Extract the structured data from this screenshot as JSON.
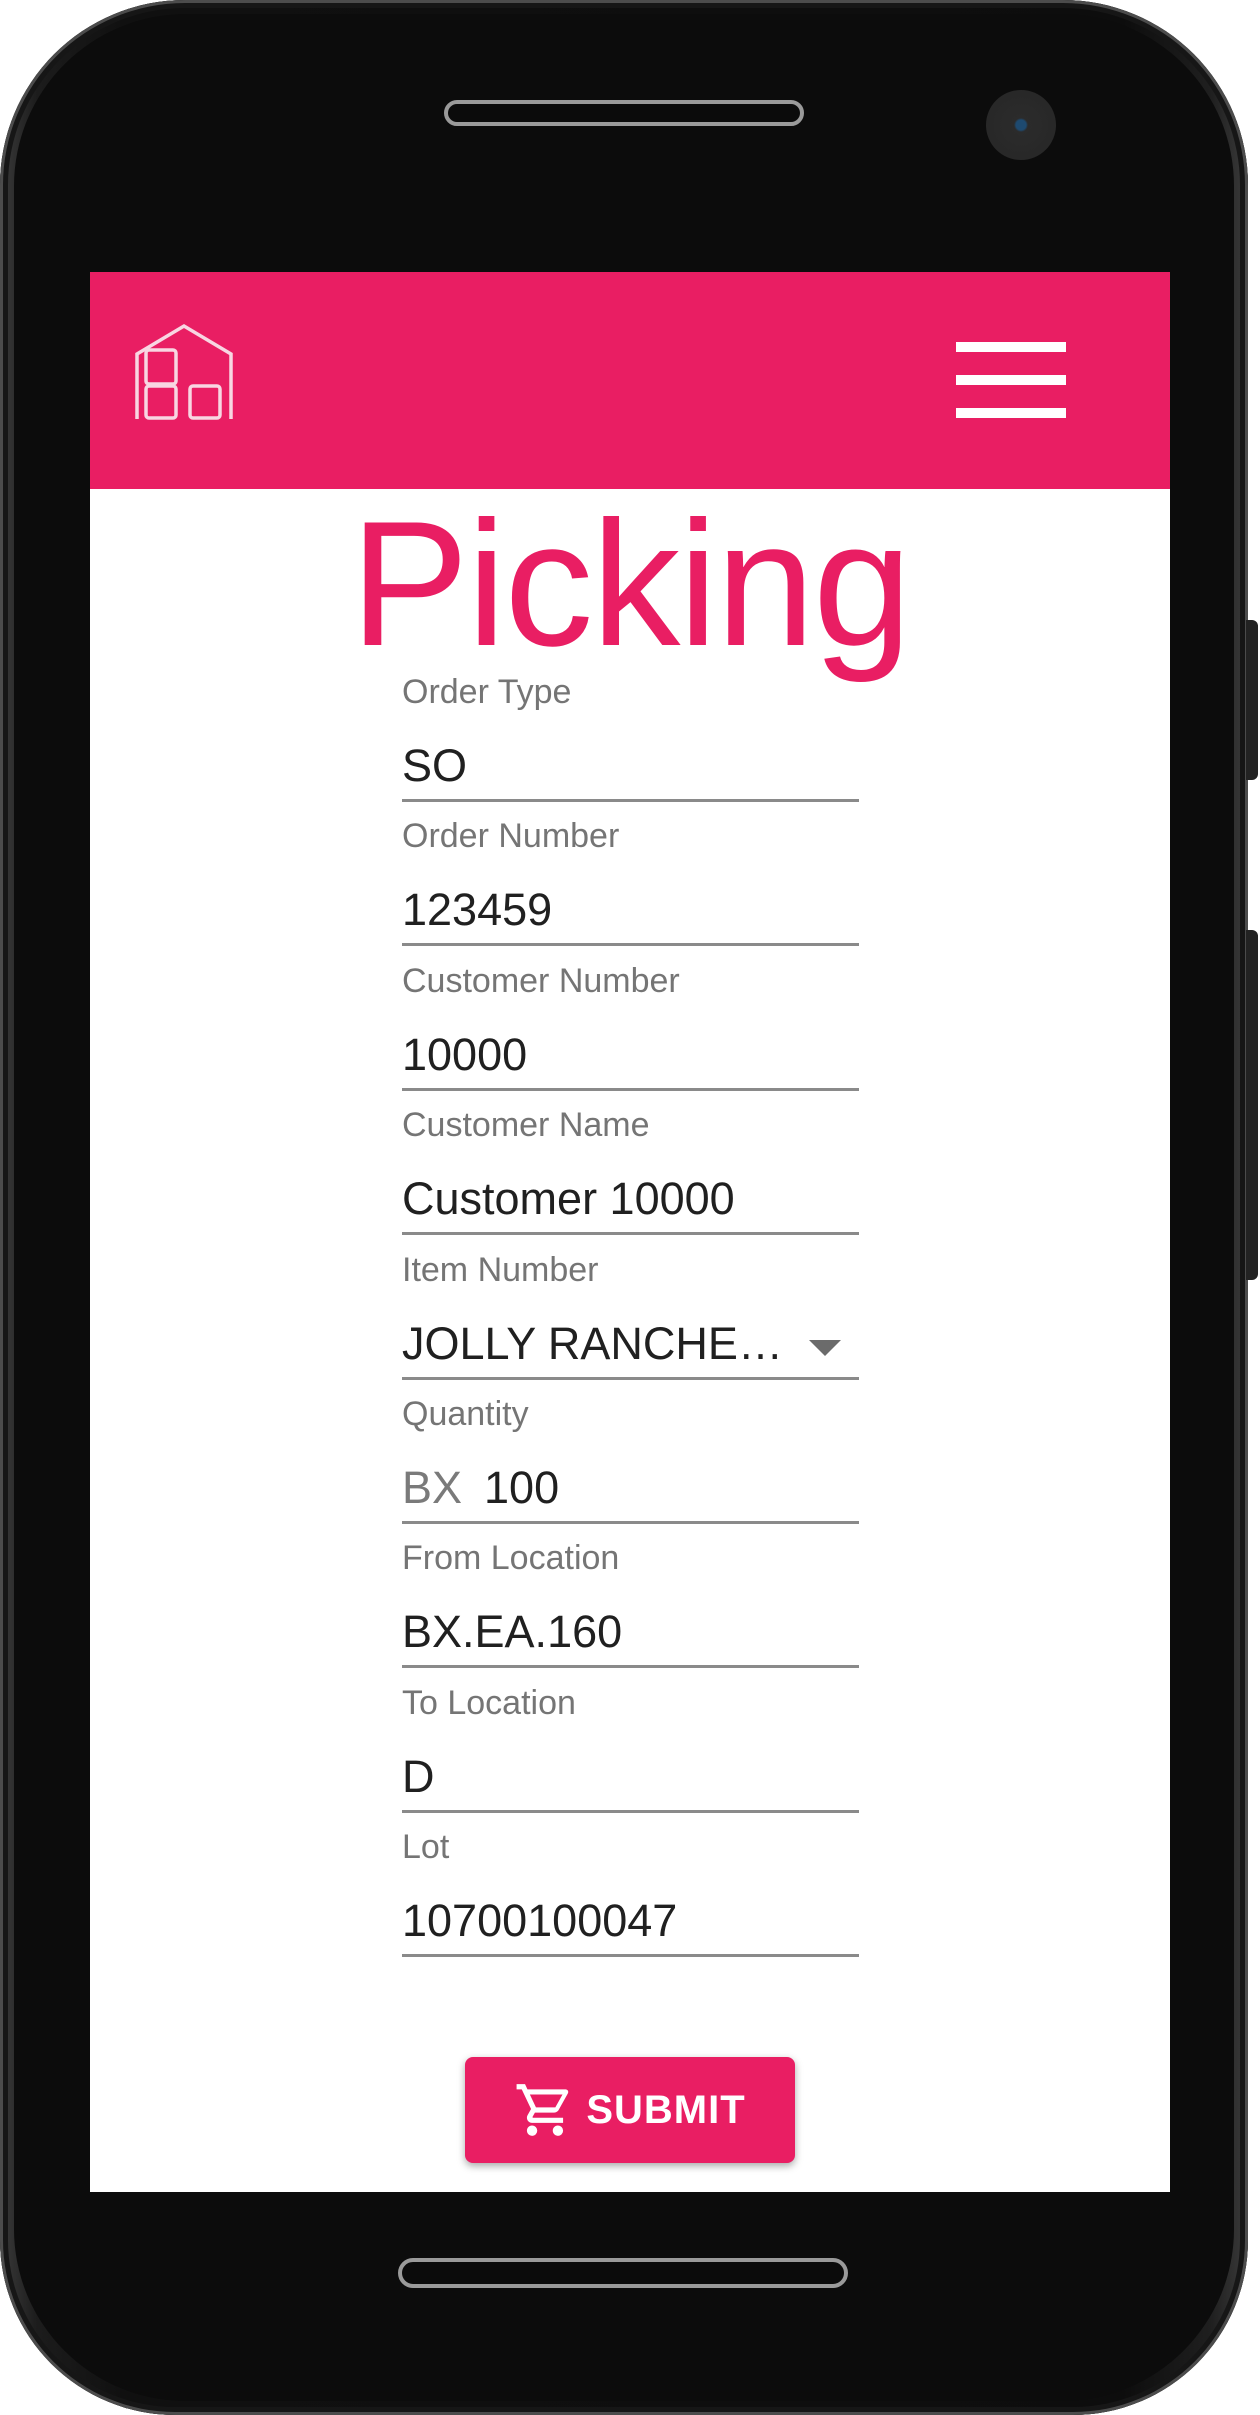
{
  "app_bar": {
    "logo_icon": "warehouse-icon",
    "menu_icon": "hamburger-menu-icon",
    "color": "#e91e63"
  },
  "page": {
    "title": "Picking"
  },
  "form": {
    "order_type": {
      "label": "Order Type",
      "value": "SO"
    },
    "order_number": {
      "label": "Order Number",
      "value": "123459"
    },
    "customer_number": {
      "label": "Customer Number",
      "value": "10000"
    },
    "customer_name": {
      "label": "Customer Name",
      "value": "Customer 10000"
    },
    "item_number": {
      "label": "Item Number",
      "value": "JOLLY RANCHE…"
    },
    "quantity": {
      "label": "Quantity",
      "unit": "BX",
      "value": "100"
    },
    "from_location": {
      "label": "From Location",
      "value": "BX.EA.160"
    },
    "to_location": {
      "label": "To Location",
      "value": "D"
    },
    "lot": {
      "label": "Lot",
      "value": "10700100047"
    }
  },
  "submit": {
    "label": "SUBMIT",
    "icon": "cart-icon"
  }
}
